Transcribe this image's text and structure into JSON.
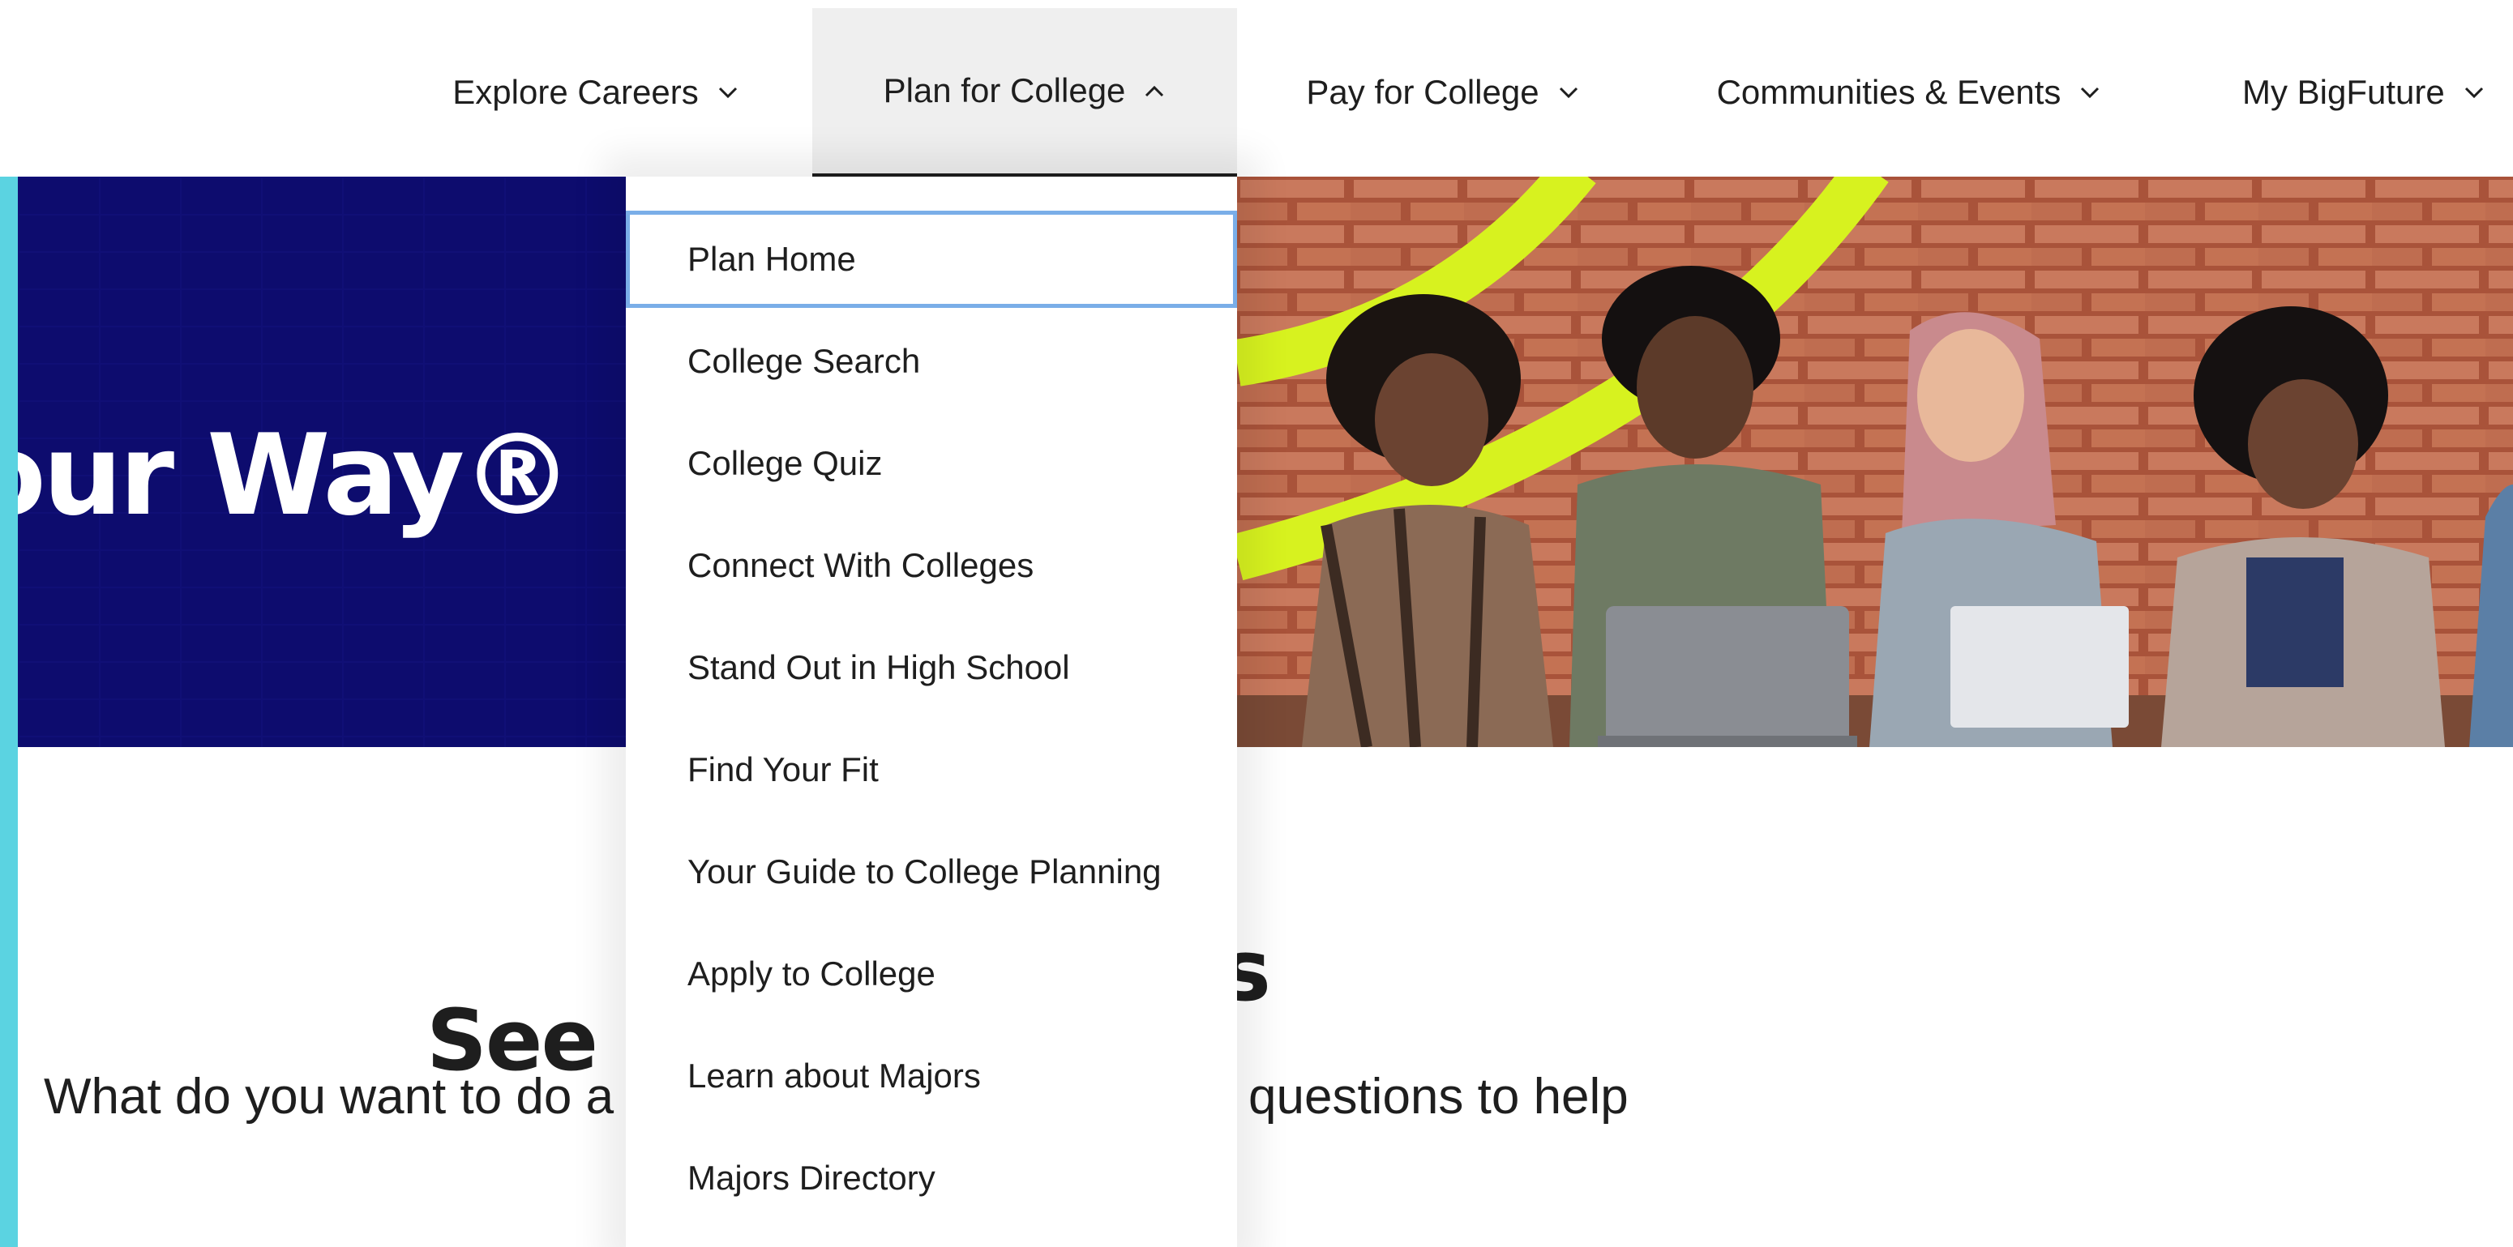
{
  "nav": {
    "items": [
      {
        "label": "Explore Careers",
        "state": "collapsed"
      },
      {
        "label": "Plan for College",
        "state": "expanded"
      },
      {
        "label": "Pay for College",
        "state": "collapsed"
      },
      {
        "label": "Communities & Events",
        "state": "collapsed"
      },
      {
        "label": "My BigFuture",
        "state": "collapsed"
      }
    ]
  },
  "dropdown": {
    "items": [
      {
        "label": "Plan Home"
      },
      {
        "label": "College Search"
      },
      {
        "label": "College Quiz"
      },
      {
        "label": "Connect With Colleges"
      },
      {
        "label": "Stand Out in High School"
      },
      {
        "label": "Find Your Fit"
      },
      {
        "label": "Your Guide to College Planning"
      },
      {
        "label": "Apply to College"
      },
      {
        "label": "Learn about Majors"
      },
      {
        "label": "Majors Directory"
      }
    ]
  },
  "hero": {
    "headline": "our Way®"
  },
  "section": {
    "title_start": "See",
    "title_end": "s",
    "subtitle_start": "What do you want to do a",
    "subtitle_end": "questions to help"
  },
  "colors": {
    "hero_navy": "#0d0c6e",
    "accent_cyan": "#5bd3e1",
    "highlight_lime": "#d7f21f",
    "focus_ring": "#7aaee8",
    "brick": "#b4654a"
  }
}
